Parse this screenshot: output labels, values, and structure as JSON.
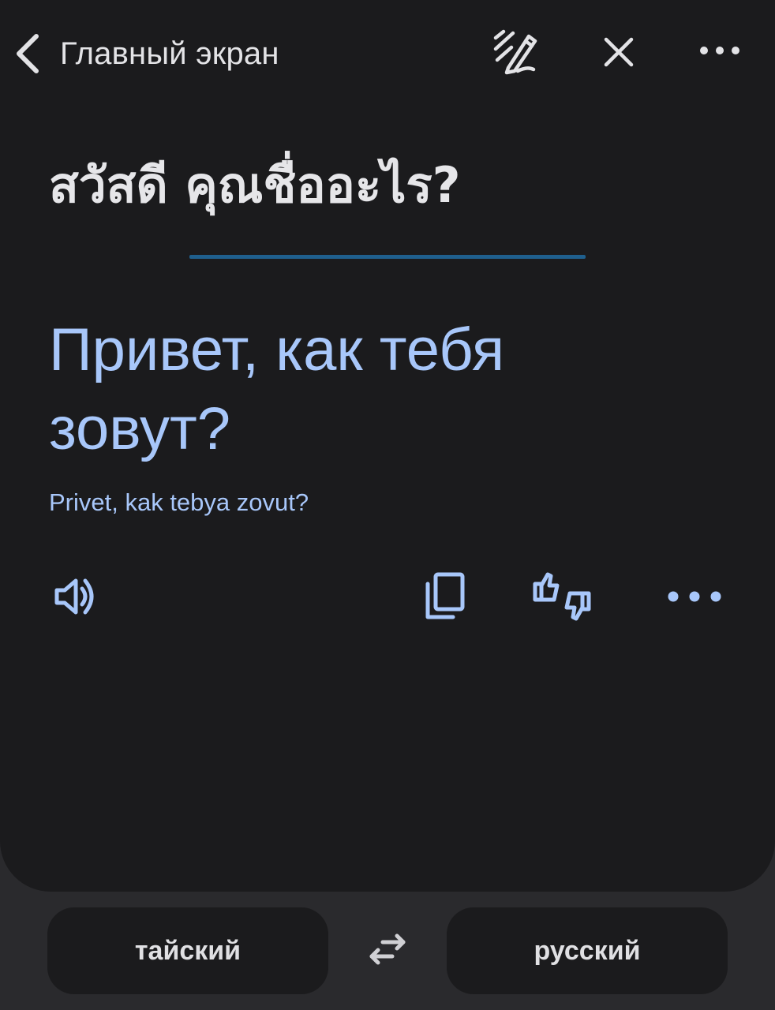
{
  "topbar": {
    "back_label": "Главный экран",
    "icons": [
      "chevron-left-icon",
      "handwriting-pen-icon",
      "close-icon",
      "more-horizontal-icon"
    ]
  },
  "source": {
    "text": "สวัสดี คุณชื่ออะไร?"
  },
  "translation": {
    "text": "Привет, как тебя зовут?",
    "transliteration": "Privet, kak tebya zovut?"
  },
  "actions": {
    "icons": [
      "speaker-icon",
      "copy-icon",
      "thumbs-up-down-icon",
      "more-horizontal-icon"
    ]
  },
  "languages": {
    "source": "тайский",
    "target": "русский",
    "swap_icon": "swap-arrows-icon"
  },
  "colors": {
    "background": "#1b1b1d",
    "accent_blue": "#a8c7fa",
    "divider": "#1f5f8d",
    "text": "#e6e6e9"
  }
}
